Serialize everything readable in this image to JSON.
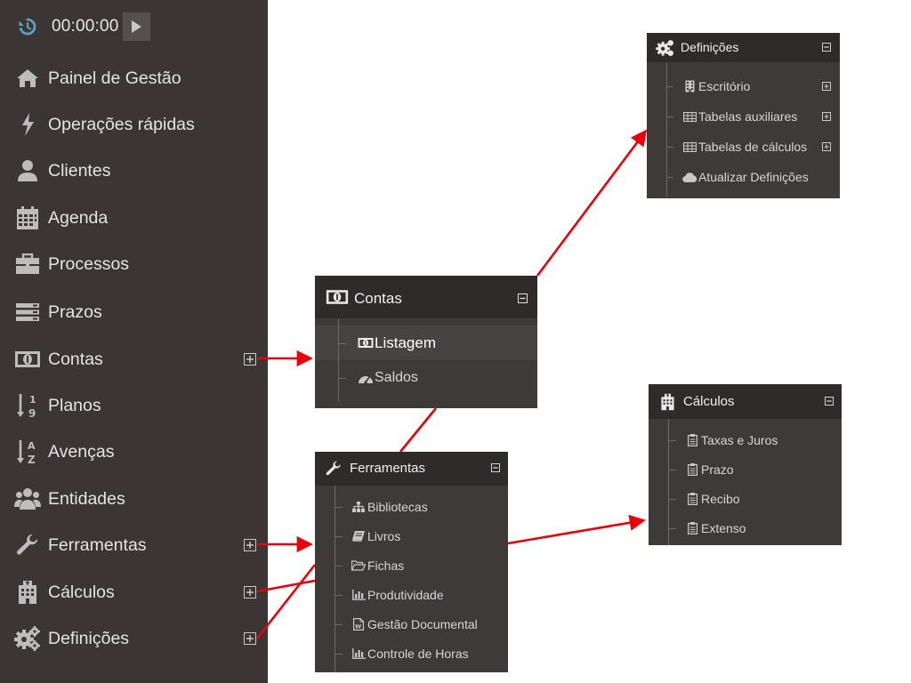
{
  "timer": {
    "value": "00:00:00",
    "refresh_icon": "refresh-icon",
    "play_icon": "play-icon"
  },
  "sidebar": {
    "items": [
      {
        "label": "Painel de Gestão",
        "icon": "home-icon"
      },
      {
        "label": "Operações rápidas",
        "icon": "bolt-icon"
      },
      {
        "label": "Clientes",
        "icon": "user-icon"
      },
      {
        "label": "Agenda",
        "icon": "calendar-icon"
      },
      {
        "label": "Processos",
        "icon": "briefcase-icon"
      },
      {
        "label": "Prazos",
        "icon": "server-icon"
      },
      {
        "label": "Contas",
        "icon": "money-icon",
        "expandable": true
      },
      {
        "label": "Planos",
        "icon": "sort-numeric-icon"
      },
      {
        "label": "Avenças",
        "icon": "sort-alpha-icon"
      },
      {
        "label": "Entidades",
        "icon": "users-icon"
      },
      {
        "label": "Ferramentas",
        "icon": "wrench-icon",
        "expandable": true
      },
      {
        "label": "Cálculos",
        "icon": "hospital-icon",
        "expandable": true
      },
      {
        "label": "Definições",
        "icon": "gears-icon",
        "expandable": true
      }
    ]
  },
  "panels": {
    "contas": {
      "title": "Contas",
      "items": [
        {
          "label": "Listagem",
          "icon": "money-icon",
          "active": true
        },
        {
          "label": "Saldos",
          "icon": "dashboard-icon"
        }
      ]
    },
    "definicoes": {
      "title": "Definições",
      "items": [
        {
          "label": "Escritório",
          "icon": "building-icon",
          "expandable": true
        },
        {
          "label": "Tabelas auxiliares",
          "icon": "table-icon",
          "expandable": true
        },
        {
          "label": "Tabelas de cálculos",
          "icon": "table-icon",
          "expandable": true
        },
        {
          "label": "Atualizar Definições",
          "icon": "cloud-icon"
        }
      ]
    },
    "ferramentas": {
      "title": "Ferramentas",
      "items": [
        {
          "label": "Bibliotecas",
          "icon": "sitemap-icon"
        },
        {
          "label": "Livros",
          "icon": "book-icon"
        },
        {
          "label": "Fichas",
          "icon": "folder-open-icon"
        },
        {
          "label": "Produtividade",
          "icon": "bar-chart-icon"
        },
        {
          "label": "Gestão Documental",
          "icon": "word-file-icon"
        },
        {
          "label": "Controle de Horas",
          "icon": "bar-chart-icon"
        }
      ]
    },
    "calculos": {
      "title": "Cálculos",
      "items": [
        {
          "label": "Taxas e Juros",
          "icon": "clipboard-icon"
        },
        {
          "label": "Prazo",
          "icon": "clipboard-icon"
        },
        {
          "label": "Recibo",
          "icon": "clipboard-icon"
        },
        {
          "label": "Extenso",
          "icon": "clipboard-icon"
        }
      ]
    }
  },
  "colors": {
    "sidebar_bg": "#3b3633",
    "panel_bg": "#3e3a37",
    "panel_header_bg": "#2f2b28",
    "arrow": "#e8000b",
    "refresh_accent": "#5aa0c8"
  }
}
